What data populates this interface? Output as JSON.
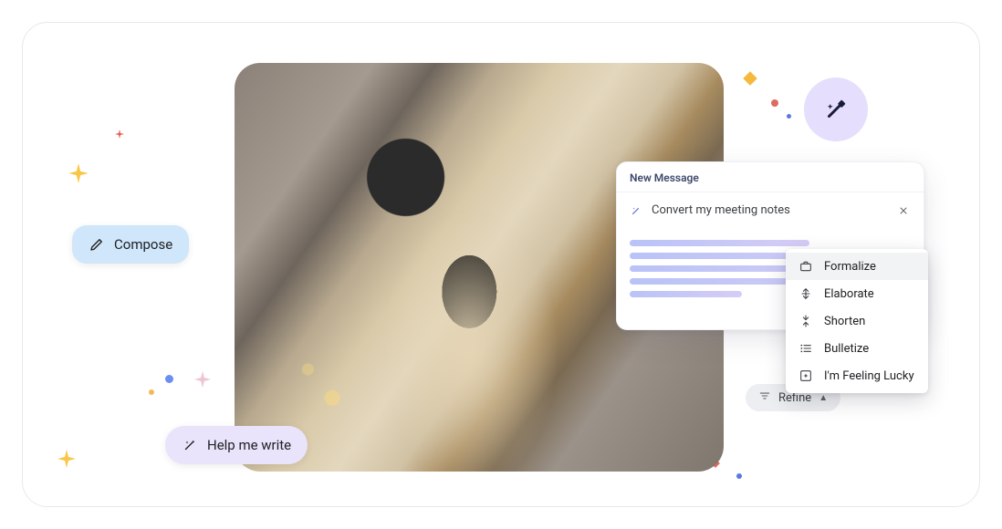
{
  "pills": {
    "compose_label": "Compose",
    "help_label": "Help me write"
  },
  "compose_window": {
    "header": "New Message",
    "subject": "Convert my meeting notes"
  },
  "menu": {
    "items": [
      {
        "label": "Formalize"
      },
      {
        "label": "Elaborate"
      },
      {
        "label": "Shorten"
      },
      {
        "label": "Bulletize"
      },
      {
        "label": "I'm Feeling Lucky"
      }
    ]
  },
  "refine": {
    "label": "Refine"
  }
}
